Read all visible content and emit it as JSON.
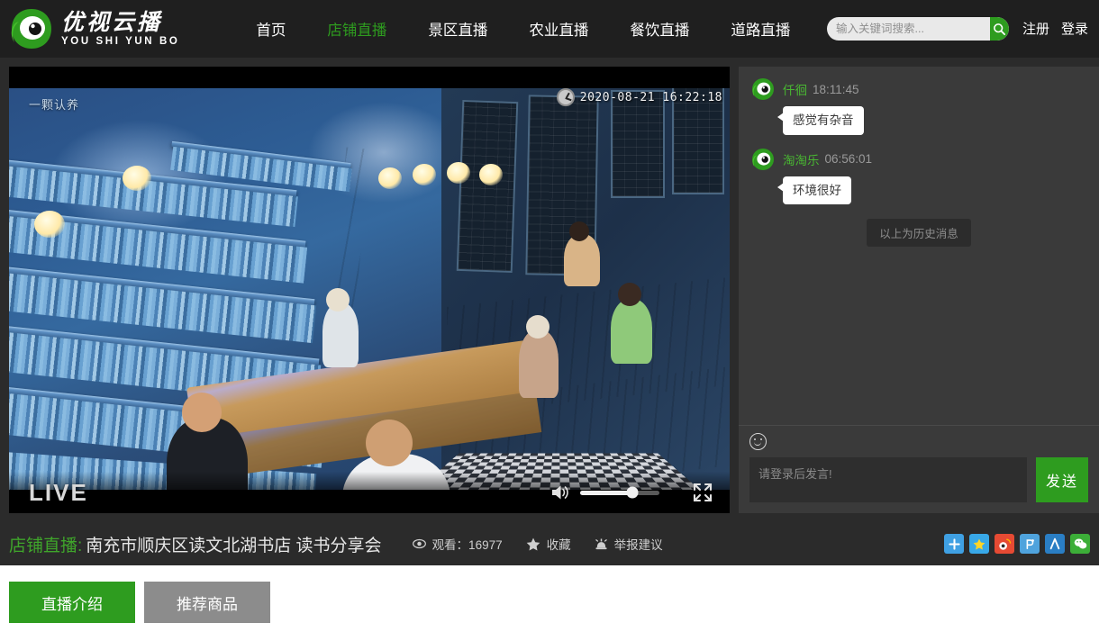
{
  "header": {
    "logo": {
      "cn": "优视云播",
      "en": "YOU SHI YUN BO",
      "icon": "eye-logo-icon"
    },
    "nav": [
      {
        "label": "首页",
        "active": false
      },
      {
        "label": "店铺直播",
        "active": true
      },
      {
        "label": "景区直播",
        "active": false
      },
      {
        "label": "农业直播",
        "active": false
      },
      {
        "label": "餐饮直播",
        "active": false
      },
      {
        "label": "道路直播",
        "active": false
      }
    ],
    "search": {
      "placeholder": "输入关键词搜索...",
      "value": "",
      "button_icon": "search-icon"
    },
    "auth": [
      {
        "label": "注册"
      },
      {
        "label": "登录"
      }
    ]
  },
  "player": {
    "overlay_sign": "一颗认养",
    "timestamp": "2020-08-21 16:22:18",
    "clock_icon": "clock-icon",
    "live_label": "LIVE",
    "volume_icon": "volume-icon",
    "volume_percent": 66,
    "fullscreen_icon": "fullscreen-icon"
  },
  "chat": {
    "messages": [
      {
        "user": "仟徊",
        "time": "18:11:45",
        "text": "感觉有杂音",
        "avatar": "eye-avatar-icon"
      },
      {
        "user": "淘淘乐",
        "time": "06:56:01",
        "text": "环境很好",
        "avatar": "eye-avatar-icon"
      }
    ],
    "history_divider": "以上为历史消息",
    "emoji_icon": "emoji-smiley-icon",
    "input": {
      "placeholder": "请登录后发言!",
      "value": ""
    },
    "send_label": "发送"
  },
  "info": {
    "category": "店铺直播:",
    "title": "南充市顺庆区读文北湖书店 读书分享会",
    "metrics": [
      {
        "icon": "eye-view-icon",
        "label": "观看：16977"
      },
      {
        "icon": "star-icon",
        "label": "收藏"
      },
      {
        "icon": "alarm-icon",
        "label": "举报建议"
      }
    ],
    "share": [
      {
        "name": "qzone-share-icon",
        "glyph": "✛",
        "color": "#3fa0e3"
      },
      {
        "name": "favorite-share-icon",
        "glyph": "★",
        "color": "#38a8e8"
      },
      {
        "name": "weibo-share-icon",
        "glyph": "◉",
        "color": "#e64a33"
      },
      {
        "name": "baidu-share-icon",
        "glyph": "Ƥ",
        "color": "#4fa3dd"
      },
      {
        "name": "renren-share-icon",
        "glyph": "人",
        "color": "#2a7ec4"
      },
      {
        "name": "wechat-share-icon",
        "glyph": "◍",
        "color": "#3cae38"
      }
    ]
  },
  "tabs": [
    {
      "label": "直播介绍",
      "active": true
    },
    {
      "label": "推荐商品",
      "active": false
    }
  ]
}
